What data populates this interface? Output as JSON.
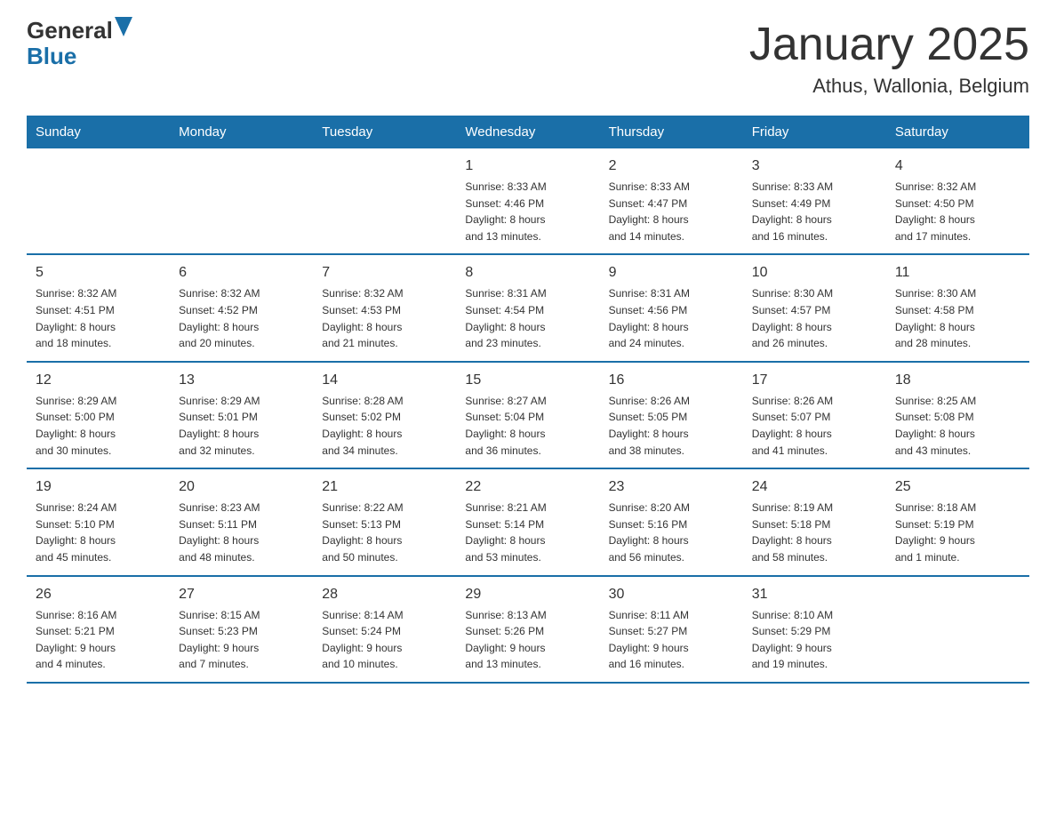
{
  "header": {
    "logo_general": "General",
    "logo_blue": "Blue",
    "title": "January 2025",
    "subtitle": "Athus, Wallonia, Belgium"
  },
  "weekdays": [
    "Sunday",
    "Monday",
    "Tuesday",
    "Wednesday",
    "Thursday",
    "Friday",
    "Saturday"
  ],
  "weeks": [
    [
      {
        "day": "",
        "info": ""
      },
      {
        "day": "",
        "info": ""
      },
      {
        "day": "",
        "info": ""
      },
      {
        "day": "1",
        "info": "Sunrise: 8:33 AM\nSunset: 4:46 PM\nDaylight: 8 hours\nand 13 minutes."
      },
      {
        "day": "2",
        "info": "Sunrise: 8:33 AM\nSunset: 4:47 PM\nDaylight: 8 hours\nand 14 minutes."
      },
      {
        "day": "3",
        "info": "Sunrise: 8:33 AM\nSunset: 4:49 PM\nDaylight: 8 hours\nand 16 minutes."
      },
      {
        "day": "4",
        "info": "Sunrise: 8:32 AM\nSunset: 4:50 PM\nDaylight: 8 hours\nand 17 minutes."
      }
    ],
    [
      {
        "day": "5",
        "info": "Sunrise: 8:32 AM\nSunset: 4:51 PM\nDaylight: 8 hours\nand 18 minutes."
      },
      {
        "day": "6",
        "info": "Sunrise: 8:32 AM\nSunset: 4:52 PM\nDaylight: 8 hours\nand 20 minutes."
      },
      {
        "day": "7",
        "info": "Sunrise: 8:32 AM\nSunset: 4:53 PM\nDaylight: 8 hours\nand 21 minutes."
      },
      {
        "day": "8",
        "info": "Sunrise: 8:31 AM\nSunset: 4:54 PM\nDaylight: 8 hours\nand 23 minutes."
      },
      {
        "day": "9",
        "info": "Sunrise: 8:31 AM\nSunset: 4:56 PM\nDaylight: 8 hours\nand 24 minutes."
      },
      {
        "day": "10",
        "info": "Sunrise: 8:30 AM\nSunset: 4:57 PM\nDaylight: 8 hours\nand 26 minutes."
      },
      {
        "day": "11",
        "info": "Sunrise: 8:30 AM\nSunset: 4:58 PM\nDaylight: 8 hours\nand 28 minutes."
      }
    ],
    [
      {
        "day": "12",
        "info": "Sunrise: 8:29 AM\nSunset: 5:00 PM\nDaylight: 8 hours\nand 30 minutes."
      },
      {
        "day": "13",
        "info": "Sunrise: 8:29 AM\nSunset: 5:01 PM\nDaylight: 8 hours\nand 32 minutes."
      },
      {
        "day": "14",
        "info": "Sunrise: 8:28 AM\nSunset: 5:02 PM\nDaylight: 8 hours\nand 34 minutes."
      },
      {
        "day": "15",
        "info": "Sunrise: 8:27 AM\nSunset: 5:04 PM\nDaylight: 8 hours\nand 36 minutes."
      },
      {
        "day": "16",
        "info": "Sunrise: 8:26 AM\nSunset: 5:05 PM\nDaylight: 8 hours\nand 38 minutes."
      },
      {
        "day": "17",
        "info": "Sunrise: 8:26 AM\nSunset: 5:07 PM\nDaylight: 8 hours\nand 41 minutes."
      },
      {
        "day": "18",
        "info": "Sunrise: 8:25 AM\nSunset: 5:08 PM\nDaylight: 8 hours\nand 43 minutes."
      }
    ],
    [
      {
        "day": "19",
        "info": "Sunrise: 8:24 AM\nSunset: 5:10 PM\nDaylight: 8 hours\nand 45 minutes."
      },
      {
        "day": "20",
        "info": "Sunrise: 8:23 AM\nSunset: 5:11 PM\nDaylight: 8 hours\nand 48 minutes."
      },
      {
        "day": "21",
        "info": "Sunrise: 8:22 AM\nSunset: 5:13 PM\nDaylight: 8 hours\nand 50 minutes."
      },
      {
        "day": "22",
        "info": "Sunrise: 8:21 AM\nSunset: 5:14 PM\nDaylight: 8 hours\nand 53 minutes."
      },
      {
        "day": "23",
        "info": "Sunrise: 8:20 AM\nSunset: 5:16 PM\nDaylight: 8 hours\nand 56 minutes."
      },
      {
        "day": "24",
        "info": "Sunrise: 8:19 AM\nSunset: 5:18 PM\nDaylight: 8 hours\nand 58 minutes."
      },
      {
        "day": "25",
        "info": "Sunrise: 8:18 AM\nSunset: 5:19 PM\nDaylight: 9 hours\nand 1 minute."
      }
    ],
    [
      {
        "day": "26",
        "info": "Sunrise: 8:16 AM\nSunset: 5:21 PM\nDaylight: 9 hours\nand 4 minutes."
      },
      {
        "day": "27",
        "info": "Sunrise: 8:15 AM\nSunset: 5:23 PM\nDaylight: 9 hours\nand 7 minutes."
      },
      {
        "day": "28",
        "info": "Sunrise: 8:14 AM\nSunset: 5:24 PM\nDaylight: 9 hours\nand 10 minutes."
      },
      {
        "day": "29",
        "info": "Sunrise: 8:13 AM\nSunset: 5:26 PM\nDaylight: 9 hours\nand 13 minutes."
      },
      {
        "day": "30",
        "info": "Sunrise: 8:11 AM\nSunset: 5:27 PM\nDaylight: 9 hours\nand 16 minutes."
      },
      {
        "day": "31",
        "info": "Sunrise: 8:10 AM\nSunset: 5:29 PM\nDaylight: 9 hours\nand 19 minutes."
      },
      {
        "day": "",
        "info": ""
      }
    ]
  ]
}
